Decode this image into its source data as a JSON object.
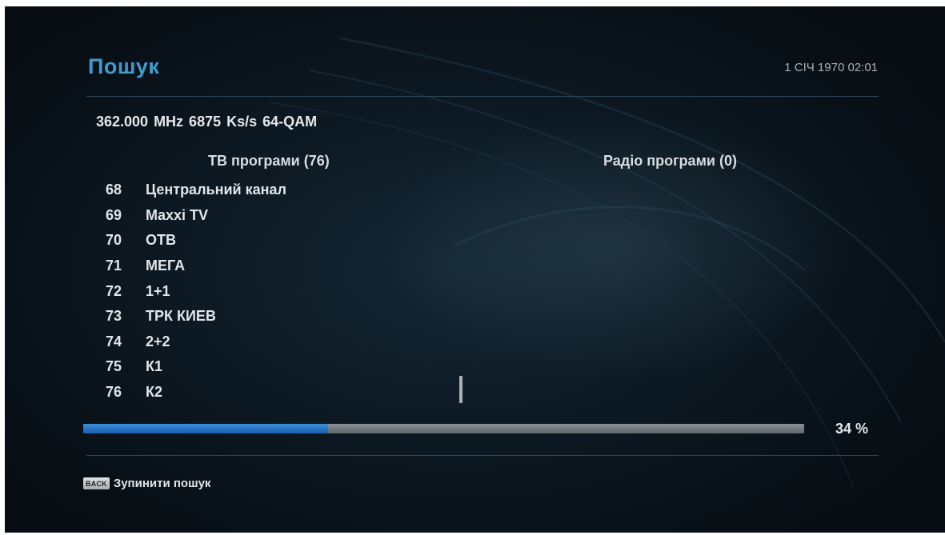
{
  "header": {
    "title": "Пошук",
    "datetime": "1 СІЧ 1970 02:01"
  },
  "tuning": {
    "frequency_line": "362.000 MHz  6875 Ks/s  64-QAM"
  },
  "columns": {
    "tv_header": "ТВ програми (76)",
    "radio_header": "Радіо програми (0)"
  },
  "tv_channels": [
    {
      "num": "68",
      "name": "Центральний канал"
    },
    {
      "num": "69",
      "name": "Maxxi TV"
    },
    {
      "num": "70",
      "name": "ОТВ"
    },
    {
      "num": "71",
      "name": "МЕГА"
    },
    {
      "num": "72",
      "name": "1+1"
    },
    {
      "num": "73",
      "name": "ТРК КИЕВ"
    },
    {
      "num": "74",
      "name": "2+2"
    },
    {
      "num": "75",
      "name": "К1"
    },
    {
      "num": "76",
      "name": "К2"
    }
  ],
  "progress": {
    "fraction": 0.34,
    "label": "34 %"
  },
  "footer": {
    "back_key": "BACK",
    "back_label": "Зупинити пошук"
  },
  "colors": {
    "title": "#3e9ccd",
    "progress_fill": "#2a78c8",
    "progress_track": "#767d82"
  }
}
